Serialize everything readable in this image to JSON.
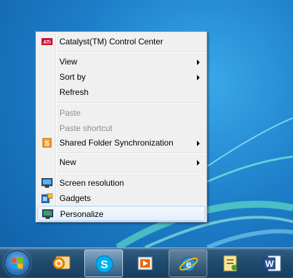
{
  "context_menu": {
    "items": [
      {
        "label": "Catalyst(TM) Control Center",
        "icon": "ati-catalyst-icon",
        "submenu": false,
        "disabled": false
      },
      {
        "label": "View",
        "submenu": true,
        "disabled": false
      },
      {
        "label": "Sort by",
        "submenu": true,
        "disabled": false
      },
      {
        "label": "Refresh",
        "submenu": false,
        "disabled": false
      },
      {
        "label": "Paste",
        "submenu": false,
        "disabled": true
      },
      {
        "label": "Paste shortcut",
        "submenu": false,
        "disabled": true
      },
      {
        "label": "Shared Folder Synchronization",
        "icon": "shared-folder-sync-icon",
        "submenu": true,
        "disabled": false
      },
      {
        "label": "New",
        "submenu": true,
        "disabled": false
      },
      {
        "label": "Screen resolution",
        "icon": "screen-resolution-icon",
        "submenu": false,
        "disabled": false
      },
      {
        "label": "Gadgets",
        "icon": "gadgets-icon",
        "submenu": false,
        "disabled": false
      },
      {
        "label": "Personalize",
        "icon": "personalize-icon",
        "submenu": false,
        "disabled": false,
        "highlighted": true
      }
    ]
  },
  "taskbar": {
    "start_button": "windows-start-orb",
    "apps": [
      {
        "name": "outlook-icon",
        "state": "normal"
      },
      {
        "name": "skype-icon",
        "state": "active"
      },
      {
        "name": "media-player-icon",
        "state": "normal"
      },
      {
        "name": "internet-explorer-icon",
        "state": "pinned"
      },
      {
        "name": "notepad-folder-icon",
        "state": "normal"
      },
      {
        "name": "word-icon",
        "state": "normal"
      }
    ],
    "word_icon_letter": "W"
  },
  "colors": {
    "desktop": "#1d7fc9",
    "menu_background": "#f0f0f0",
    "highlight_border": "#aecff7",
    "disabled_text": "#8d8d8d"
  }
}
